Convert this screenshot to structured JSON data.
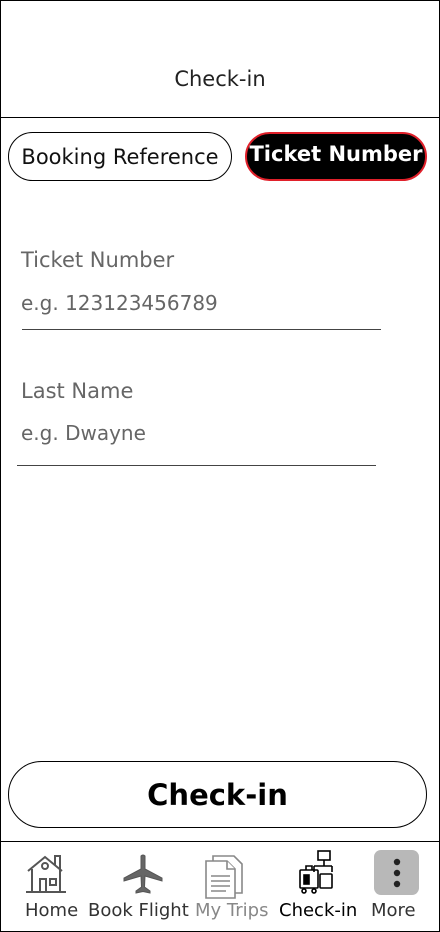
{
  "header": {
    "title": "Check-in"
  },
  "segments": {
    "booking_reference": "Booking Reference",
    "ticket_number": "Ticket Number",
    "selected": "Ticket Number"
  },
  "form": {
    "ticket_label": "Ticket Number",
    "ticket_placeholder": "e.g. 123123456789",
    "ticket_value": "",
    "lastname_label": "Last Name",
    "lastname_placeholder": "e.g. Dwayne",
    "lastname_value": ""
  },
  "actions": {
    "checkin_label": "Check-in"
  },
  "tabbar": {
    "items": [
      {
        "label": "Home",
        "icon": "home-icon",
        "color": "#333333"
      },
      {
        "label": "Book Flight",
        "icon": "airplane-icon",
        "color": "#333333"
      },
      {
        "label": "My Trips",
        "icon": "document-icon",
        "color": "#888888"
      },
      {
        "label": "Check-in",
        "icon": "luggage-icon",
        "color": "#000000",
        "active": true
      },
      {
        "label": "More",
        "icon": "more-vertical-icon",
        "color": "#333333"
      }
    ]
  },
  "colors": {
    "accent": "#e0202a",
    "selected_bg": "#000000",
    "more_bg": "#b8b8b8"
  }
}
